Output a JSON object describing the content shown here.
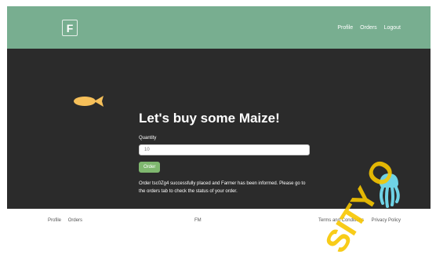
{
  "header": {
    "logo_letter": "F",
    "nav": [
      "Profile",
      "Orders",
      "Logout"
    ]
  },
  "hero": {
    "title_prefix": "Let's buy some ",
    "title_crop": "Maize",
    "title_suffix": "!",
    "quantity_label": "Quantity",
    "quantity_value": "10",
    "order_button": "Order",
    "message": "Order tsc0Zg4 successfully placed and Farmer has been informed. Please go to the orders tab to check the status of your order."
  },
  "footer": {
    "left_links": [
      "Profile",
      "Orders"
    ],
    "center_text": "FM",
    "right_links": [
      "Terms and Conditions",
      "Privacy Policy"
    ]
  },
  "watermark_text": "SITY O",
  "colors": {
    "header_bg": "#78ae90",
    "hero_bg": "#2b2b2b",
    "button_bg": "#7fb86f",
    "fish": "#f6c05a",
    "jellyfish": "#6fd3e6",
    "watermark": "#f7c600"
  }
}
